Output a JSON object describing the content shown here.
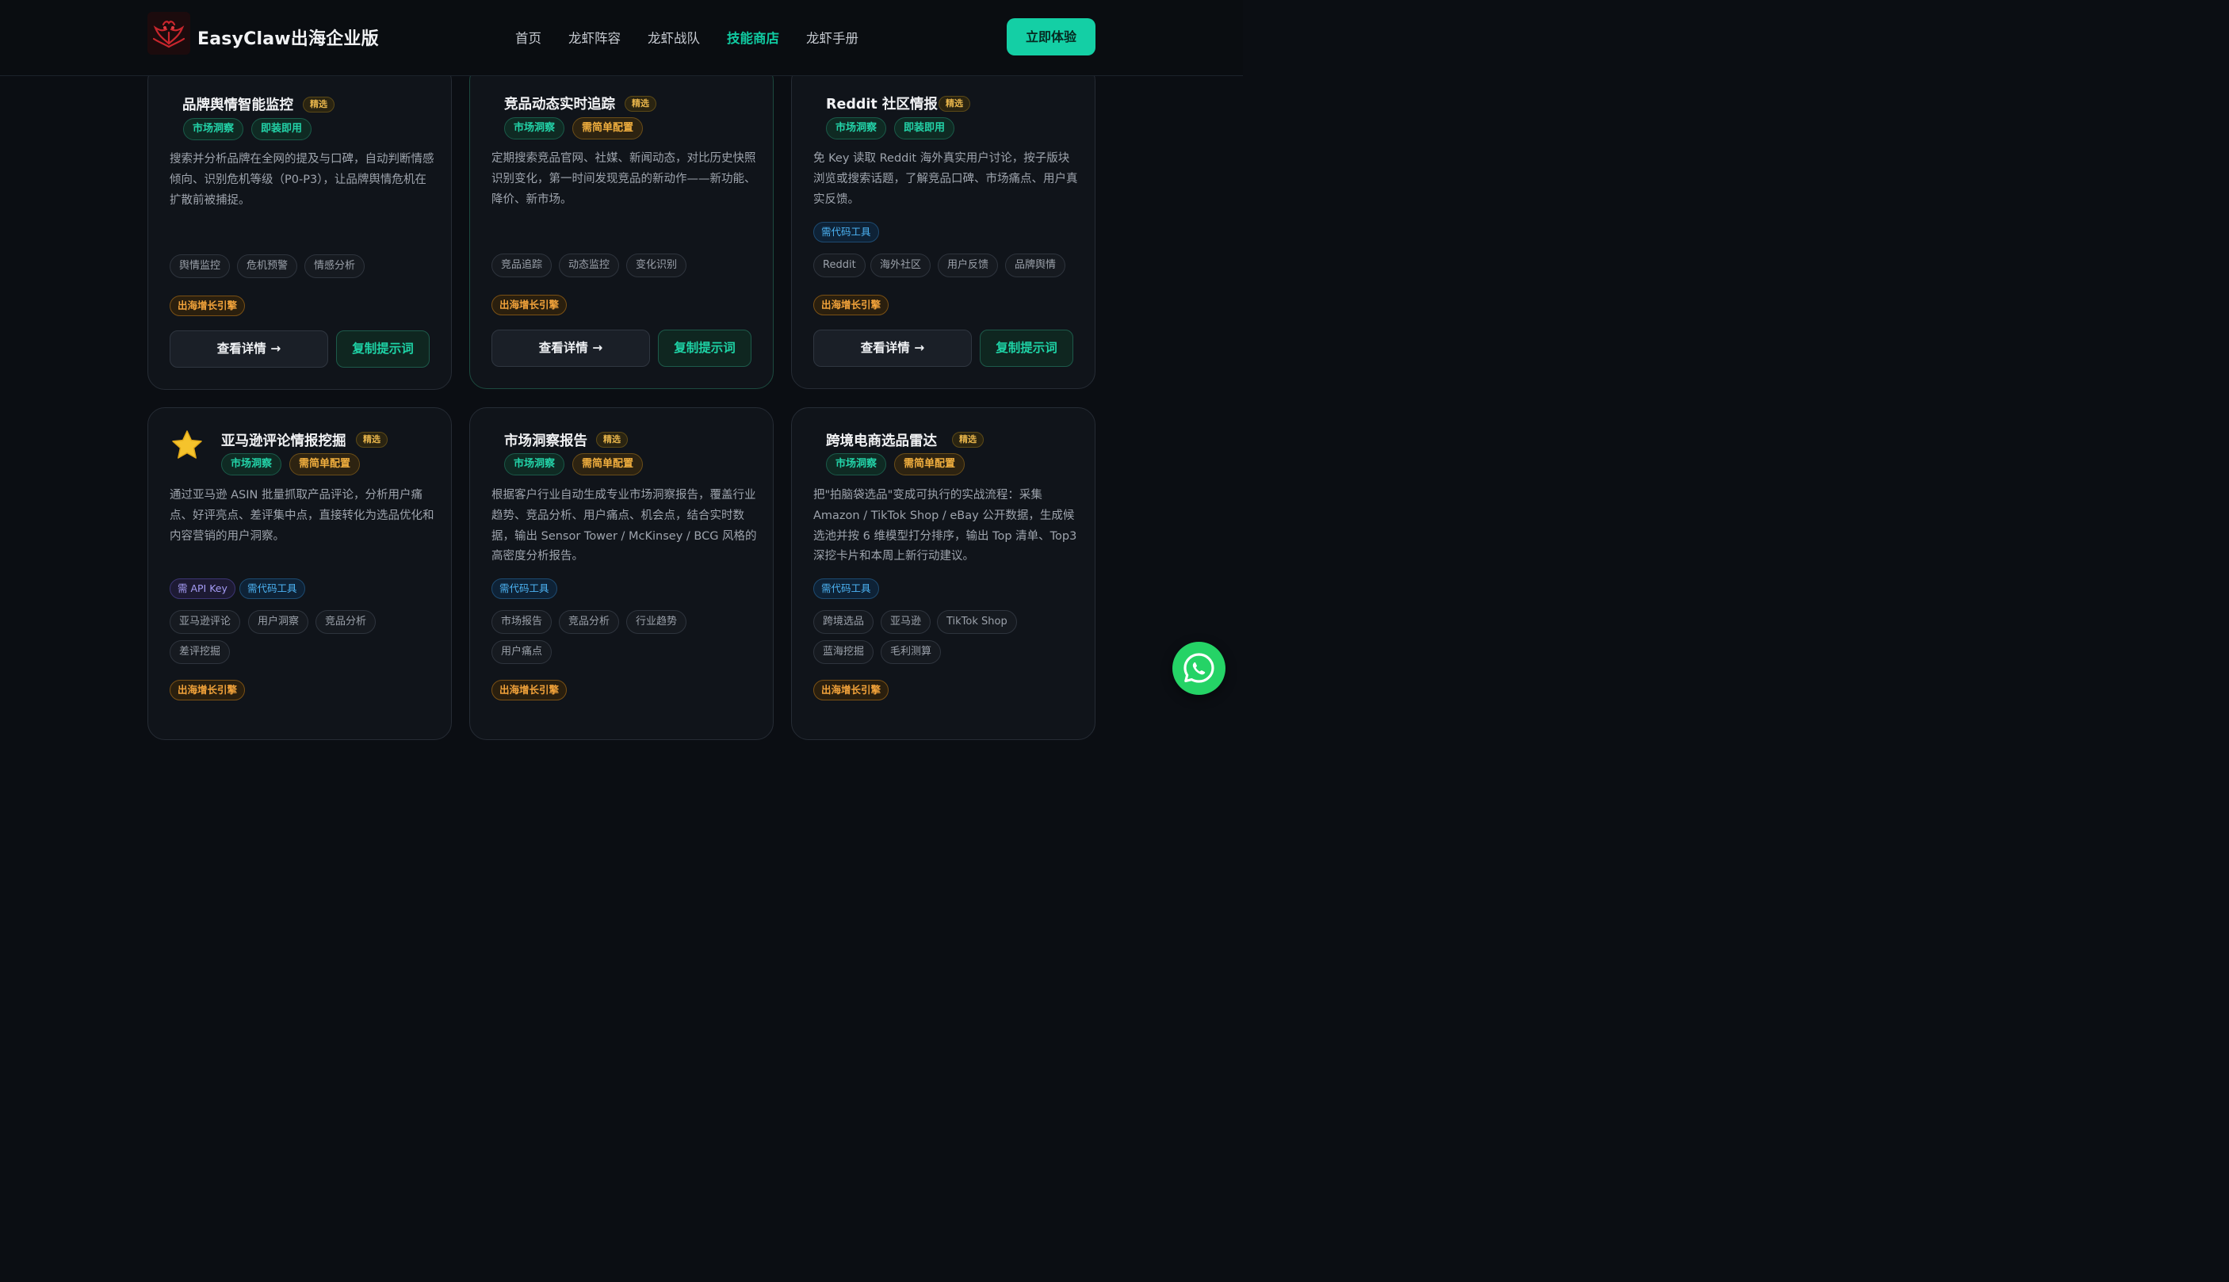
{
  "header": {
    "brand": "EasyClaw出海企业版",
    "nav": [
      {
        "label": "首页",
        "active": false
      },
      {
        "label": "龙虾阵容",
        "active": false
      },
      {
        "label": "龙虾战队",
        "active": false
      },
      {
        "label": "技能商店",
        "active": true
      },
      {
        "label": "龙虾手册",
        "active": false
      }
    ],
    "cta_label": "立即体验"
  },
  "labels": {
    "featured": "精选",
    "detail": "查看详情 →",
    "copy": "复制提示词",
    "growth": "出海增长引擎"
  },
  "cards": [
    {
      "title": "品牌舆情智能监控",
      "pills": [
        {
          "label": "市场洞察",
          "kind": "green"
        },
        {
          "label": "即装即用",
          "kind": "green"
        }
      ],
      "description": "搜索并分析品牌在全网的提及与口碑，自动判断情感倾向、识别危机等级（P0-P3），让品牌舆情危机在扩散前被捕捉。",
      "requirements": [],
      "tags": [
        "舆情监控",
        "危机预警",
        "情感分析"
      ],
      "growth": "出海增长引擎"
    },
    {
      "title": "竞品动态实时追踪",
      "pills": [
        {
          "label": "市场洞察",
          "kind": "green"
        },
        {
          "label": "需简单配置",
          "kind": "orange"
        }
      ],
      "description": "定期搜索竞品官网、社媒、新闻动态，对比历史快照识别变化，第一时间发现竞品的新动作——新功能、降价、新市场。",
      "requirements": [],
      "tags": [
        "竞品追踪",
        "动态监控",
        "变化识别"
      ],
      "growth": "出海增长引擎"
    },
    {
      "title": "Reddit 社区情报",
      "pills": [
        {
          "label": "市场洞察",
          "kind": "green"
        },
        {
          "label": "即装即用",
          "kind": "green"
        }
      ],
      "description": "免 Key 读取 Reddit 海外真实用户讨论，按子版块浏览或搜索话题，了解竞品口碑、市场痛点、用户真实反馈。",
      "requirements": [
        {
          "label": "需代码工具",
          "kind": "blue"
        }
      ],
      "tags": [
        "Reddit",
        "海外社区",
        "用户反馈",
        "品牌舆情"
      ],
      "growth": "出海增长引擎"
    },
    {
      "title": "亚马逊评论情报挖掘",
      "icon": "star-icon",
      "pills": [
        {
          "label": "市场洞察",
          "kind": "green"
        },
        {
          "label": "需简单配置",
          "kind": "orange"
        }
      ],
      "description": "通过亚马逊 ASIN 批量抓取产品评论，分析用户痛点、好评亮点、差评集中点，直接转化为选品优化和内容营销的用户洞察。",
      "requirements": [
        {
          "label": "需 API Key",
          "kind": "purple"
        },
        {
          "label": "需代码工具",
          "kind": "blue"
        }
      ],
      "tags": [
        "亚马逊评论",
        "用户洞察",
        "竞品分析",
        "差评挖掘"
      ],
      "growth": "出海增长引擎"
    },
    {
      "title": "市场洞察报告",
      "pills": [
        {
          "label": "市场洞察",
          "kind": "green"
        },
        {
          "label": "需简单配置",
          "kind": "orange"
        }
      ],
      "description": "根据客户行业自动生成专业市场洞察报告，覆盖行业趋势、竞品分析、用户痛点、机会点，结合实时数据，输出 Sensor Tower / McKinsey / BCG 风格的高密度分析报告。",
      "requirements": [
        {
          "label": "需代码工具",
          "kind": "blue"
        }
      ],
      "tags": [
        "市场报告",
        "竞品分析",
        "行业趋势",
        "用户痛点"
      ],
      "growth": "出海增长引擎"
    },
    {
      "title": "跨境电商选品雷达",
      "pills": [
        {
          "label": "市场洞察",
          "kind": "green"
        },
        {
          "label": "需简单配置",
          "kind": "orange"
        }
      ],
      "description": "把\"拍脑袋选品\"变成可执行的实战流程：采集 Amazon / TikTok Shop / eBay 公开数据，生成候选池并按 6 维模型打分排序，输出 Top 清单、Top3 深挖卡片和本周上新行动建议。",
      "requirements": [
        {
          "label": "需代码工具",
          "kind": "blue"
        }
      ],
      "tags": [
        "跨境选品",
        "亚马逊",
        "TikTok Shop",
        "蓝海挖掘",
        "毛利测算"
      ],
      "growth": "出海增长引擎"
    }
  ],
  "colors": {
    "accent": "#14cfa5",
    "background": "#0b0e13",
    "card": "#10141a",
    "featured": "#e5b34a",
    "whatsapp": "#25d366"
  },
  "floating": {
    "icon": "whatsapp-icon"
  }
}
